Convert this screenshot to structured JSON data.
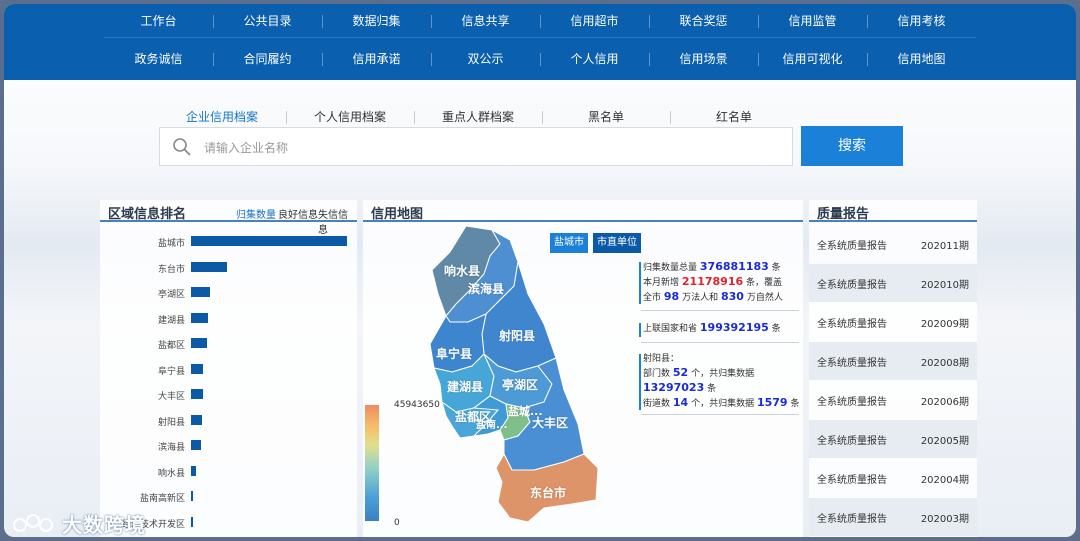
{
  "nav": {
    "row1": [
      "工作台",
      "公共目录",
      "数据归集",
      "信息共享",
      "信用超市",
      "联合奖惩",
      "信用监管",
      "信用考核"
    ],
    "row2": [
      "政务诚信",
      "合同履约",
      "信用承诺",
      "双公示",
      "个人信用",
      "信用场景",
      "信用可视化",
      "信用地图"
    ]
  },
  "search": {
    "tabs": [
      "企业信用档案",
      "个人信用档案",
      "重点人群档案",
      "黑名单",
      "红名单"
    ],
    "placeholder": "请输入企业名称",
    "button": "搜索"
  },
  "left_panel": {
    "title": "区域信息排名",
    "legend": [
      "归集数量",
      "良好信息",
      "失信信息"
    ],
    "rows": [
      {
        "name": "盐城市",
        "value": 1.0
      },
      {
        "name": "东台市",
        "value": 0.23
      },
      {
        "name": "亭湖区",
        "value": 0.12
      },
      {
        "name": "建湖县",
        "value": 0.11
      },
      {
        "name": "盐都区",
        "value": 0.1
      },
      {
        "name": "阜宁县",
        "value": 0.08
      },
      {
        "name": "大丰区",
        "value": 0.075
      },
      {
        "name": "射阳县",
        "value": 0.07
      },
      {
        "name": "滨海县",
        "value": 0.065
      },
      {
        "name": "响水县",
        "value": 0.035
      },
      {
        "name": "盐南高新区",
        "value": 0.012
      },
      {
        "name": "经济技术开发区",
        "value": 0.01
      }
    ]
  },
  "map_panel": {
    "title": "信用地图",
    "chip_city": "盐城市",
    "chip_unit": "市直单位",
    "legend_max": "45943650",
    "legend_min": "0",
    "regions": [
      "响水县",
      "滨海县",
      "射阳县",
      "阜宁县",
      "建湖县",
      "亭湖区",
      "盐都区",
      "盐南...",
      "盐城...",
      "大丰区",
      "东台市"
    ],
    "stats1": {
      "l1a": "归集数量总量",
      "v1": "376881183",
      "l1b": "条",
      "l2a": "本月新增",
      "v2": "21178916",
      "l2b": "条，覆盖",
      "l3a": "全市",
      "v3": "98",
      "l3b": "万法人和",
      "v4": "830",
      "l3c": "万自然人"
    },
    "stats2": {
      "l1": "上联国家和省",
      "v1": "199392195",
      "l2": "条"
    },
    "stats3": {
      "title": "射阳县：",
      "l1a": "部门数",
      "v1": "52",
      "l1b": "个，共归集数据",
      "v2": "13297023",
      "l2": "条",
      "l3a": "街道数",
      "v3": "14",
      "l3b": "个，共归集数据",
      "v4": "1579",
      "l3c": "条"
    },
    "colors": {
      "xiangshui": "#5f89a6",
      "binhai": "#4d8fd0",
      "sheyang": "#3f86cf",
      "funing": "#3d86cf",
      "jianhu": "#47a6d8",
      "tinghu": "#4c9ad6",
      "yandu": "#4aa6d8",
      "yannan": "#3f9bd5",
      "yancheng": "#7fbf8a",
      "dafeng": "#4a8fd3",
      "dongtai": "#dd9468"
    }
  },
  "right_panel": {
    "title": "质量报告",
    "reports": [
      {
        "name": "全系统质量报告",
        "period": "202011期"
      },
      {
        "name": "全系统质量报告",
        "period": "202010期"
      },
      {
        "name": "全系统质量报告",
        "period": "202009期"
      },
      {
        "name": "全系统质量报告",
        "period": "202008期"
      },
      {
        "name": "全系统质量报告",
        "period": "202006期"
      },
      {
        "name": "全系统质量报告",
        "period": "202005期"
      },
      {
        "name": "全系统质量报告",
        "period": "202004期"
      },
      {
        "name": "全系统质量报告",
        "period": "202003期"
      }
    ]
  },
  "watermark": "大数跨境"
}
